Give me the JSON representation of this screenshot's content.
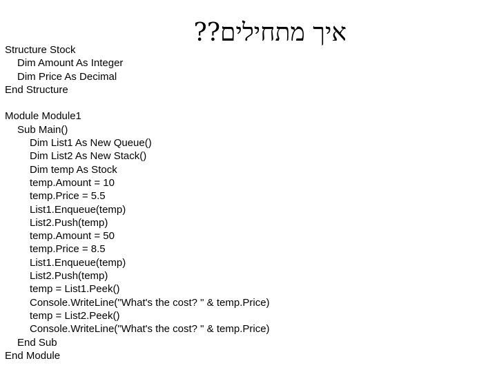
{
  "title": "איך מתחילים??",
  "code": {
    "structure": [
      {
        "text": "Structure Stock",
        "indent": 0
      },
      {
        "text": "Dim Amount As Integer",
        "indent": 1
      },
      {
        "text": "Dim Price As Decimal",
        "indent": 1
      },
      {
        "text": "End Structure",
        "indent": 0
      }
    ],
    "module": [
      {
        "text": "Module Module1",
        "indent": 0
      },
      {
        "text": "Sub Main()",
        "indent": 1
      },
      {
        "text": "Dim List1 As New Queue()",
        "indent": 2
      },
      {
        "text": "Dim List2 As New Stack()",
        "indent": 2
      },
      {
        "text": "Dim temp As Stock",
        "indent": 2
      },
      {
        "text": "temp.Amount = 10",
        "indent": 2
      },
      {
        "text": "temp.Price = 5.5",
        "indent": 2
      },
      {
        "text": "List1.Enqueue(temp)",
        "indent": 2
      },
      {
        "text": "List2.Push(temp)",
        "indent": 2
      },
      {
        "text": "temp.Amount = 50",
        "indent": 2
      },
      {
        "text": "temp.Price = 8.5",
        "indent": 2
      },
      {
        "text": "List1.Enqueue(temp)",
        "indent": 2
      },
      {
        "text": "List2.Push(temp)",
        "indent": 2
      },
      {
        "text": "temp = List1.Peek()",
        "indent": 2
      },
      {
        "text": "Console.WriteLine(\"What's the cost? \" & temp.Price)",
        "indent": 2
      },
      {
        "text": "temp = List2.Peek()",
        "indent": 2
      },
      {
        "text": "Console.WriteLine(\"What's the cost? \" & temp.Price)",
        "indent": 2
      },
      {
        "text": "End Sub",
        "indent": 1
      },
      {
        "text": "End Module",
        "indent": 0
      }
    ]
  }
}
